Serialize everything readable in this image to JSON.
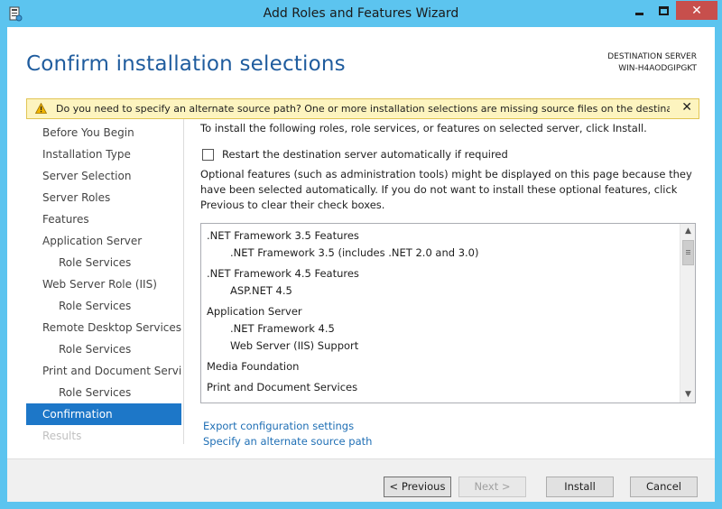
{
  "window": {
    "title": "Add Roles and Features Wizard",
    "minimize_glyph": "—",
    "maximize_glyph": "□",
    "close_glyph": "✕"
  },
  "header": {
    "title": "Confirm installation selections",
    "destination_label": "DESTINATION SERVER",
    "destination_server": "WIN-H4AODGIPGKT"
  },
  "warning": {
    "text": "Do you need to specify an alternate source path? One or more installation selections are missing source files on the destinati...",
    "close": "✕"
  },
  "nav": {
    "items": [
      {
        "label": "Before You Begin",
        "level": 0,
        "state": "normal"
      },
      {
        "label": "Installation Type",
        "level": 0,
        "state": "normal"
      },
      {
        "label": "Server Selection",
        "level": 0,
        "state": "normal"
      },
      {
        "label": "Server Roles",
        "level": 0,
        "state": "normal"
      },
      {
        "label": "Features",
        "level": 0,
        "state": "normal"
      },
      {
        "label": "Application Server",
        "level": 0,
        "state": "normal"
      },
      {
        "label": "Role Services",
        "level": 1,
        "state": "normal"
      },
      {
        "label": "Web Server Role (IIS)",
        "level": 0,
        "state": "normal"
      },
      {
        "label": "Role Services",
        "level": 1,
        "state": "normal"
      },
      {
        "label": "Remote Desktop Services",
        "level": 0,
        "state": "normal"
      },
      {
        "label": "Role Services",
        "level": 1,
        "state": "normal"
      },
      {
        "label": "Print and Document Servi...",
        "level": 0,
        "state": "normal"
      },
      {
        "label": "Role Services",
        "level": 1,
        "state": "normal"
      },
      {
        "label": "Confirmation",
        "level": 0,
        "state": "active"
      },
      {
        "label": "Results",
        "level": 0,
        "state": "disabled"
      }
    ]
  },
  "content": {
    "intro": "To install the following roles, role services, or features on selected server, click Install.",
    "restart_label": "Restart the destination server automatically if required",
    "optional_text": "Optional features (such as administration tools) might be displayed on this page because they have been selected automatically. If you do not want to install these optional features, click Previous to clear their check boxes."
  },
  "selections": [
    {
      "label": ".NET Framework 3.5 Features",
      "level": 0
    },
    {
      "label": ".NET Framework 3.5 (includes .NET 2.0 and 3.0)",
      "level": 1
    },
    {
      "label": ".NET Framework 4.5 Features",
      "level": 0
    },
    {
      "label": "ASP.NET 4.5",
      "level": 1
    },
    {
      "label": "Application Server",
      "level": 0
    },
    {
      "label": ".NET Framework 4.5",
      "level": 1
    },
    {
      "label": "Web Server (IIS) Support",
      "level": 1
    },
    {
      "label": "Media Foundation",
      "level": 0
    },
    {
      "label": "Print and Document Services",
      "level": 0
    }
  ],
  "links": {
    "export": "Export configuration settings",
    "alternate_source": "Specify an alternate source path"
  },
  "footer": {
    "previous": "< Previous",
    "next": "Next >",
    "install": "Install",
    "cancel": "Cancel"
  },
  "colors": {
    "titlebar": "#5cc4ef",
    "header_title": "#1f5c9e",
    "nav_active": "#1d77c8",
    "link": "#1f6fb5",
    "warning_bg": "#fdf4bf",
    "close_button": "#c74f4c"
  }
}
